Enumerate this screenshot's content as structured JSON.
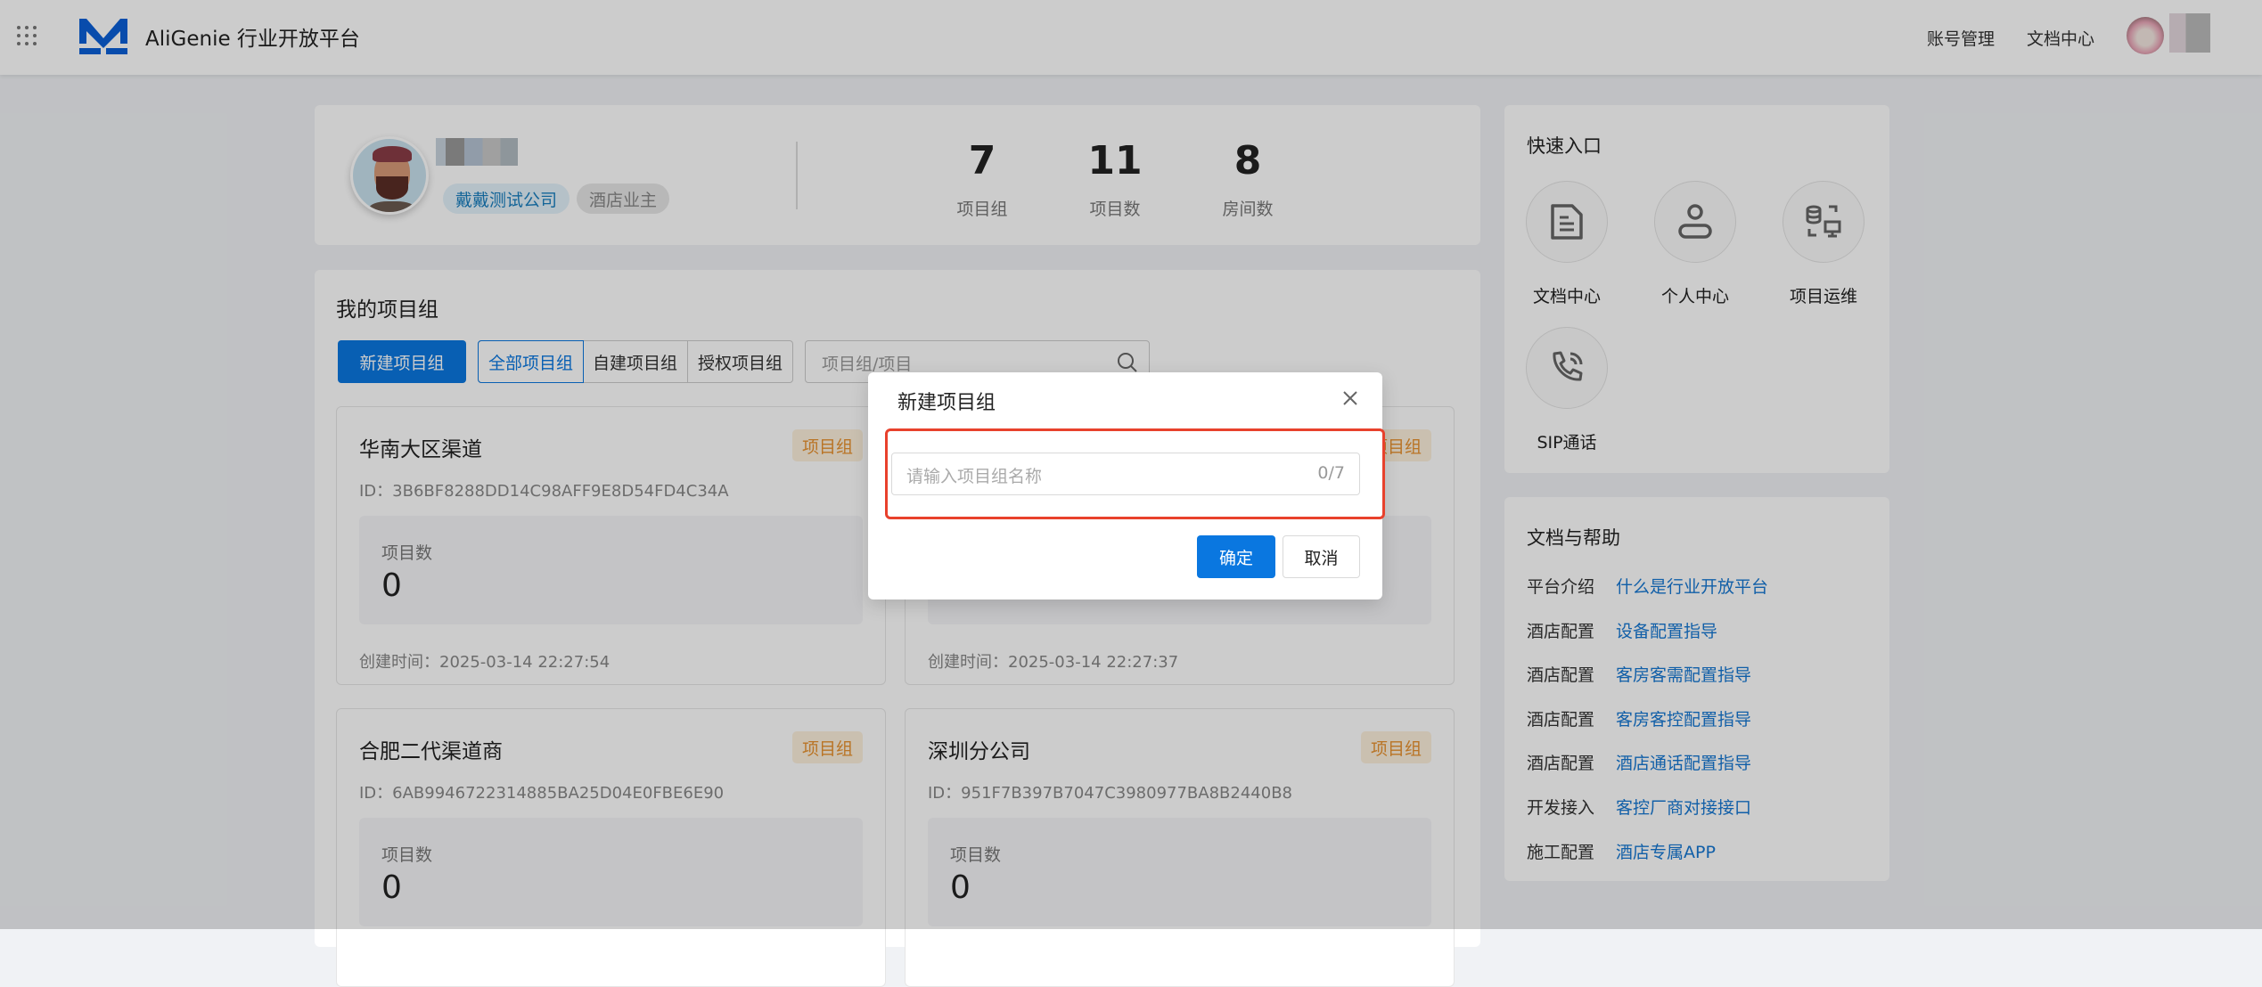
{
  "header": {
    "title": "AliGenie 行业开放平台",
    "nav": [
      "账号管理",
      "文档中心"
    ]
  },
  "profile": {
    "company_tag": "戴戴测试公司",
    "role_tag": "酒店业主",
    "stats": [
      {
        "value": "7",
        "label": "项目组"
      },
      {
        "value": "11",
        "label": "项目数"
      },
      {
        "value": "8",
        "label": "房间数"
      }
    ]
  },
  "projects": {
    "title": "我的项目组",
    "new_button": "新建项目组",
    "filters": [
      "全部项目组",
      "自建项目组",
      "授权项目组"
    ],
    "search_placeholder": "项目组/项目",
    "cards": [
      {
        "name": "华南大区渠道",
        "tag": "项目组",
        "id": "ID：3B6BF8288DD14C98AFF9E8D54FD4C34A",
        "count_label": "项目数",
        "count": "0",
        "created": "创建时间：2025-03-14 22:27:54"
      },
      {
        "name": "",
        "tag": "项目组",
        "id": "",
        "count_label": "",
        "count": "",
        "created": "创建时间：2025-03-14 22:27:37"
      },
      {
        "name": "合肥二代渠道商",
        "tag": "项目组",
        "id": "ID：6AB9946722314885BA25D04E0FBE6E90",
        "count_label": "项目数",
        "count": "0",
        "created": ""
      },
      {
        "name": "深圳分公司",
        "tag": "项目组",
        "id": "ID：951F7B397B7047C3980977BA8B2440B8",
        "count_label": "项目数",
        "count": "0",
        "created": ""
      }
    ]
  },
  "quick": {
    "title": "快速入口",
    "items": [
      {
        "label": "文档中心",
        "icon": "document-icon"
      },
      {
        "label": "个人中心",
        "icon": "user-icon"
      },
      {
        "label": "项目运维",
        "icon": "ops-icon"
      },
      {
        "label": "SIP通话",
        "icon": "phone-icon"
      }
    ]
  },
  "docs": {
    "title": "文档与帮助",
    "rows": [
      {
        "k": "平台介绍",
        "v": "什么是行业开放平台"
      },
      {
        "k": "酒店配置",
        "v": "设备配置指导"
      },
      {
        "k": "酒店配置",
        "v": "客房客需配置指导"
      },
      {
        "k": "酒店配置",
        "v": "客房客控配置指导"
      },
      {
        "k": "酒店配置",
        "v": "酒店通话配置指导"
      },
      {
        "k": "开发接入",
        "v": "客控厂商对接接口"
      },
      {
        "k": "施工配置",
        "v": "酒店专属APP"
      }
    ]
  },
  "modal": {
    "title": "新建项目组",
    "placeholder": "请输入项目组名称",
    "counter": "0/7",
    "ok": "确定",
    "cancel": "取消"
  },
  "colors": {
    "primary": "#0a77e0",
    "tag_orange": "#e8912f",
    "highlight": "#e8412c"
  }
}
